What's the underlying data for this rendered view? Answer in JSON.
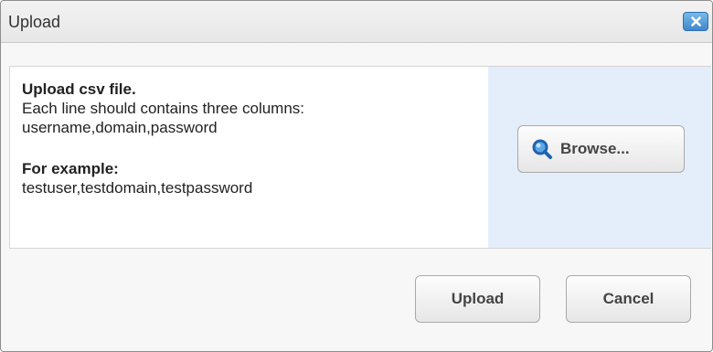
{
  "dialog": {
    "title": "Upload",
    "close_icon": "close-icon"
  },
  "instructions": {
    "heading": "Upload csv file.",
    "line1": "Each line should contains three columns:",
    "line2": "username,domain,password",
    "example_heading": "For example:",
    "example_value": "testuser,testdomain,testpassword"
  },
  "browse": {
    "label": "Browse...",
    "icon": "magnifier-icon"
  },
  "footer": {
    "upload_label": "Upload",
    "cancel_label": "Cancel"
  },
  "colors": {
    "close_button": "#3f86cc",
    "browse_panel": "#e4eefb",
    "search_icon": "#2b79c4"
  }
}
